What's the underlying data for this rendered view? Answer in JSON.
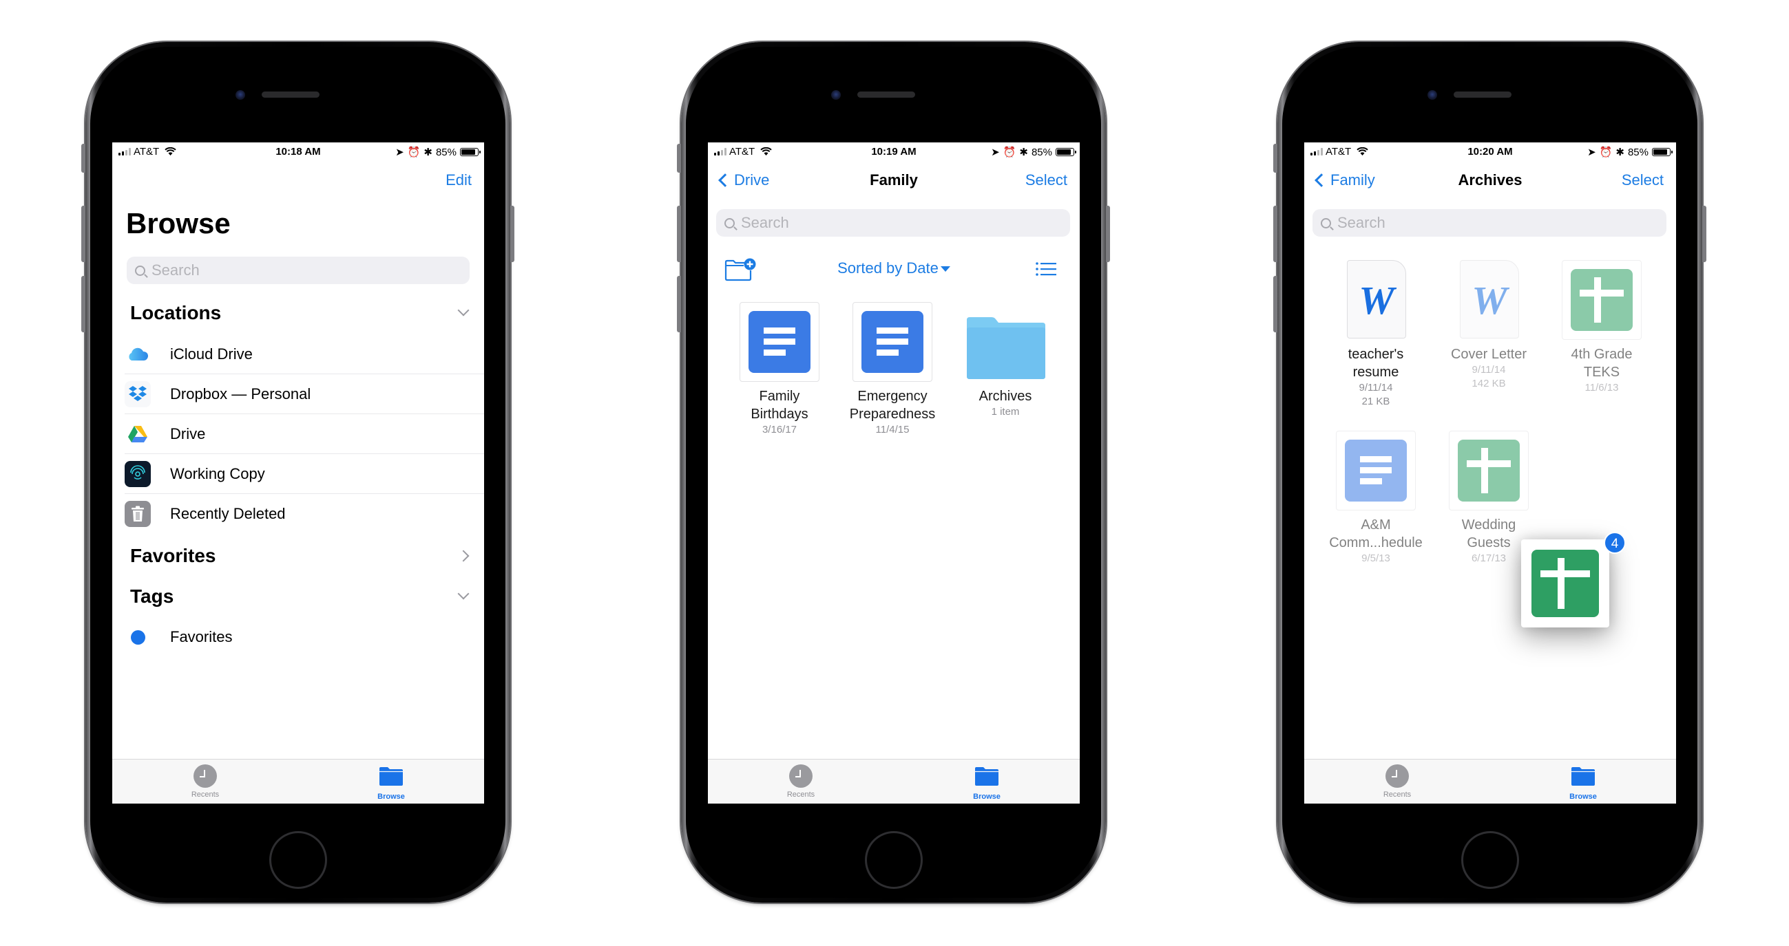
{
  "phones": [
    {
      "status": {
        "carrier": "AT&T",
        "time": "10:18 AM",
        "battery": "85%",
        "battery_level": 0.85
      },
      "nav": {
        "edit": "Edit"
      },
      "title": "Browse",
      "search_placeholder": "Search",
      "locations_header": "Locations",
      "locations": [
        {
          "label": "iCloud Drive",
          "icon": "icloud-icon"
        },
        {
          "label": "Dropbox — Personal",
          "icon": "dropbox-icon"
        },
        {
          "label": "Drive",
          "icon": "google-drive-icon"
        },
        {
          "label": "Working Copy",
          "icon": "working-copy-icon"
        },
        {
          "label": "Recently Deleted",
          "icon": "trash-icon"
        }
      ],
      "favorites_header": "Favorites",
      "tags_header": "Tags",
      "tags": [
        {
          "label": "Favorites",
          "color": "#1a73e8"
        }
      ],
      "tabs": {
        "recents": "Recents",
        "browse": "Browse"
      }
    },
    {
      "status": {
        "carrier": "AT&T",
        "time": "10:19 AM",
        "battery": "85%",
        "battery_level": 0.85
      },
      "nav": {
        "back": "Drive",
        "title": "Family",
        "select": "Select"
      },
      "search_placeholder": "Search",
      "sort_label": "Sorted by Date",
      "items": [
        {
          "name_line1": "Family",
          "name_line2": "Birthdays",
          "meta": "3/16/17",
          "type": "google-doc"
        },
        {
          "name_line1": "Emergency",
          "name_line2": "Preparedness",
          "meta": "11/4/15",
          "type": "google-doc"
        },
        {
          "name_line1": "Archives",
          "name_line2": "",
          "meta": "1 item",
          "type": "folder"
        }
      ],
      "tabs": {
        "recents": "Recents",
        "browse": "Browse"
      }
    },
    {
      "status": {
        "carrier": "AT&T",
        "time": "10:20 AM",
        "battery": "85%",
        "battery_level": 0.85
      },
      "nav": {
        "back": "Family",
        "title": "Archives",
        "select": "Select"
      },
      "search_placeholder": "Search",
      "items": [
        {
          "name_line1": "teacher's",
          "name_line2": "resume",
          "meta1": "9/11/14",
          "meta2": "21 KB",
          "type": "word-doc"
        },
        {
          "name_line1": "Cover Letter",
          "name_line2": "",
          "meta1": "9/11/14",
          "meta2": "142 KB",
          "type": "word-doc"
        },
        {
          "name_line1": "4th Grade",
          "name_line2": "TEKS",
          "meta1": "11/6/13",
          "meta2": "",
          "type": "google-sheet"
        },
        {
          "name_line1": "A&M",
          "name_line2": "Comm...hedule",
          "meta1": "9/5/13",
          "meta2": "",
          "type": "google-doc"
        },
        {
          "name_line1": "Wedding",
          "name_line2": "Guests",
          "meta1": "6/17/13",
          "meta2": "",
          "type": "google-sheet"
        }
      ],
      "drag_count": "4",
      "tabs": {
        "recents": "Recents",
        "browse": "Browse"
      }
    }
  ],
  "colors": {
    "accent": "#1c7ce3",
    "gdoc": "#3b7be5",
    "gsheet": "#2e9f63",
    "folder": "#6fc1f0"
  }
}
